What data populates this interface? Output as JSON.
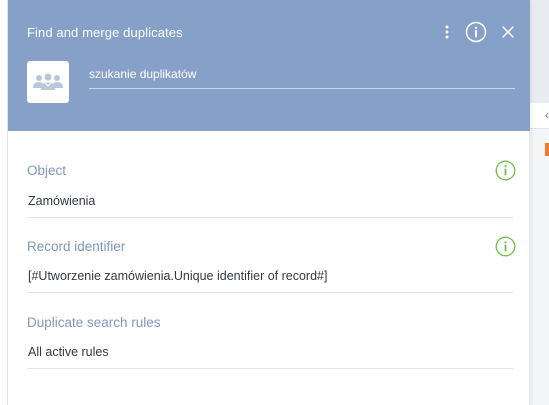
{
  "panel": {
    "title": "Find and merge duplicates",
    "name_value": "szukanie duplikatów",
    "icons": {
      "menu": "vertical-dots-icon",
      "info": "info-icon",
      "close": "close-icon",
      "avatar": "users-group-icon",
      "hint": "info-circle-icon"
    }
  },
  "fields": {
    "object": {
      "label": "Object",
      "value": "Zamówienia"
    },
    "record_identifier": {
      "label": "Record identifier",
      "value": "[#Utworzenie zamówienia.Unique identifier of record#]"
    },
    "duplicate_rules": {
      "label": "Duplicate search rules",
      "value": "All active rules"
    }
  },
  "colors": {
    "header_bg": "#87a0c8",
    "label": "#7f98bf",
    "hint_green": "#6fbf4a",
    "edge_orange": "#f0792e"
  }
}
